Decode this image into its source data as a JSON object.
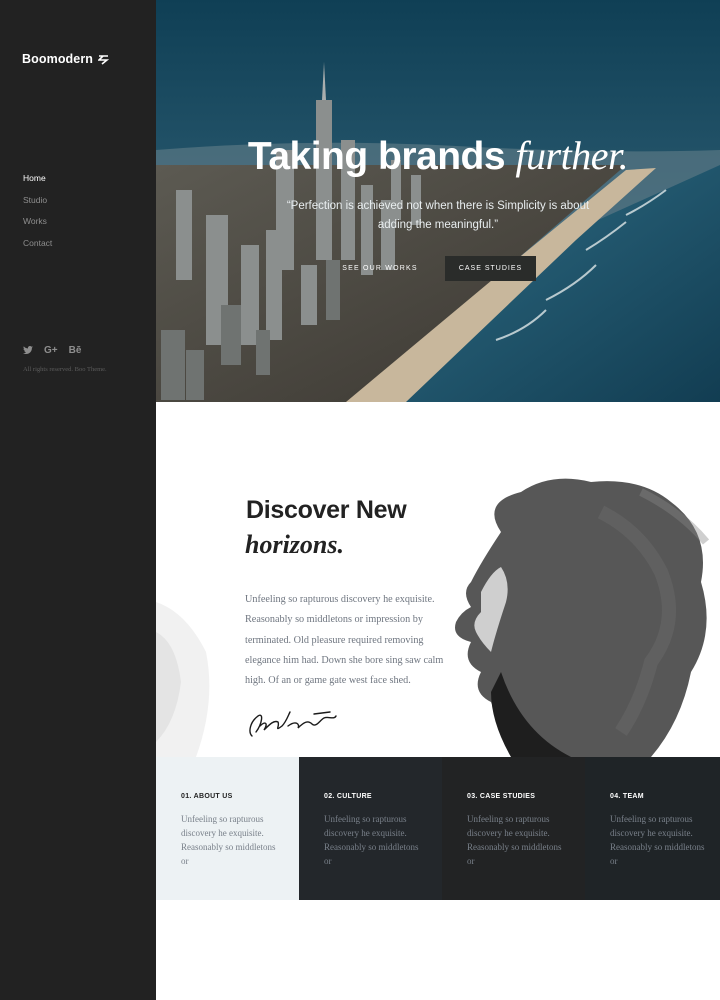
{
  "sidebar": {
    "brand": "Boomodern",
    "nav": [
      "Home",
      "Studio",
      "Works",
      "Contact"
    ],
    "social": [
      "twitter-icon",
      "google-plus-icon",
      "behance-icon"
    ],
    "social_labels": {
      "google": "G+",
      "behance": "Bē"
    },
    "copyright": "All rights reserved. Boo Theme."
  },
  "hero": {
    "title_main": "Taking brands",
    "title_italic": "further.",
    "quote": "“Perfection is achieved not when there is Simplicity is about adding the meaningful.”",
    "btn_works": "SEE OUR WORKS",
    "btn_case": "CASE STUDIES"
  },
  "discover": {
    "title": "Discover New",
    "title_italic": "horizons.",
    "text": "Unfeeling so rapturous discovery he exquisite. Reasonably so middletons or impression by terminated. Old pleasure required removing elegance him had. Down she bore sing saw calm high. Of an or game gate west face shed."
  },
  "cards": [
    {
      "title": "01. ABOUT US",
      "text": "Unfeeling so rapturous discovery he exquisite. Reasonably so middletons or"
    },
    {
      "title": "02. CULTURE",
      "text": "Unfeeling so rapturous discovery he exquisite. Reasonably so middletons or"
    },
    {
      "title": "03. CASE STUDIES",
      "text": "Unfeeling so rapturous discovery he exquisite. Reasonably so middletons or"
    },
    {
      "title": "04. TEAM",
      "text": "Unfeeling so rapturous discovery he exquisite. Reasonably so middletons or"
    }
  ],
  "colors": {
    "sidebar_bg": "#222222",
    "sky": "#1c4f66",
    "ocean": "#1f5a70",
    "card_light": "#edf2f4",
    "card_dark": "#23272b"
  }
}
